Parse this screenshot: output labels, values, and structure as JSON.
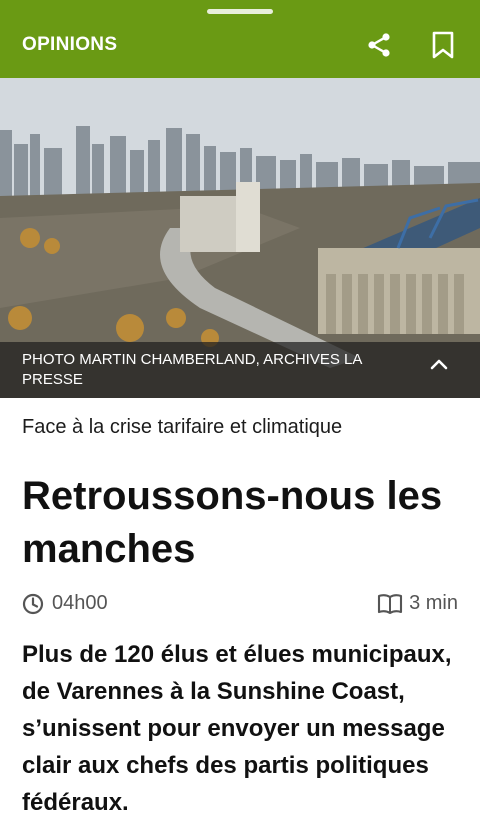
{
  "header": {
    "section": "OPINIONS",
    "share_icon": "share-icon",
    "bookmark_icon": "bookmark-icon",
    "background_color": "#6a9a14"
  },
  "photo": {
    "caption": "PHOTO MARTIN CHAMBERLAND, ARCHIVES LA PRESSE",
    "toggle_icon": "chevron-up-icon"
  },
  "article": {
    "kicker": "Face à la crise tarifaire et climatique",
    "title": "Retroussons-nous les manches",
    "time": "04h00",
    "read_time": "3 min",
    "lede": "Plus de 120 élus et élues municipaux, de Varennes à la Sunshine Coast, s’unissent pour envoyer un message clair aux chefs des partis politiques fédéraux."
  }
}
